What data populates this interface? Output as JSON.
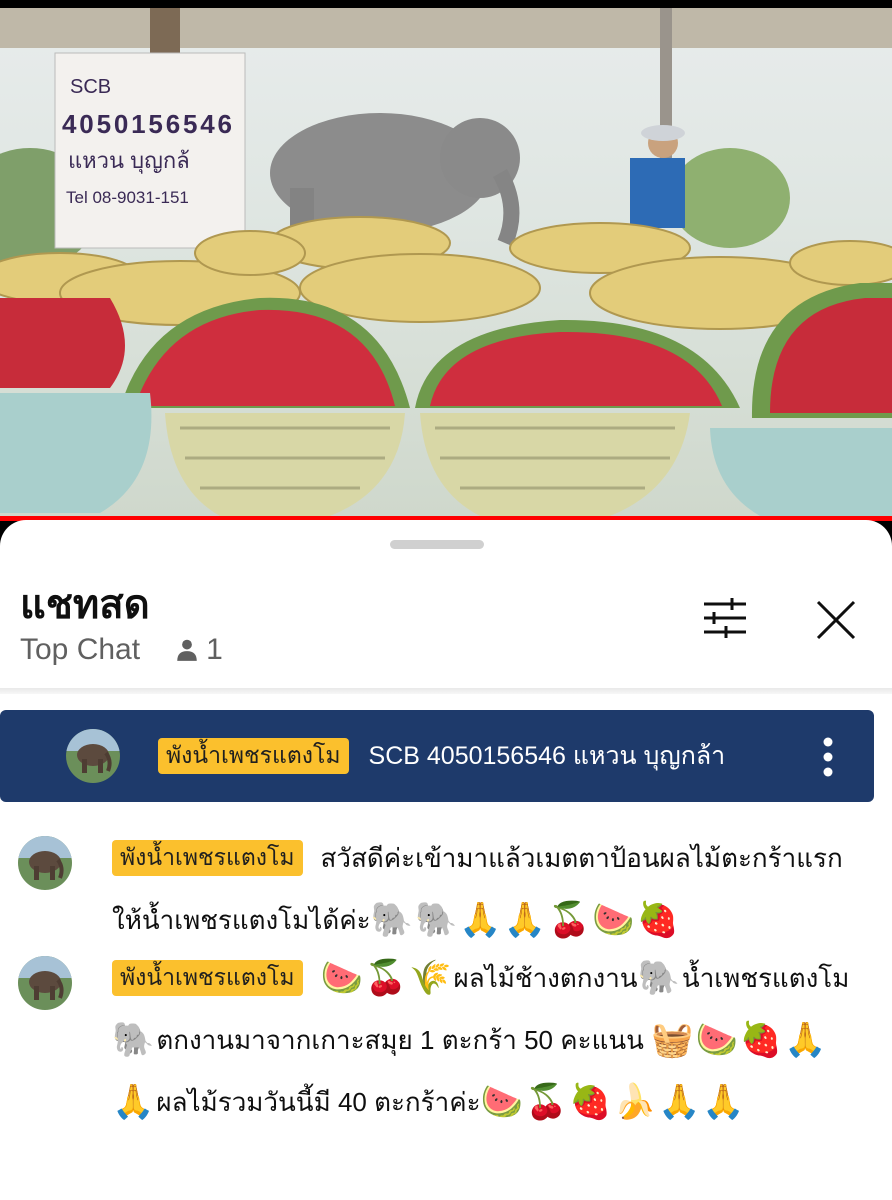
{
  "video": {
    "sign_lines": [
      "SCB",
      "4050156546",
      "แหวน บุญกล้",
      "Tel 08-9031-151"
    ]
  },
  "chat": {
    "title": "แชทสด",
    "mode": "Top Chat",
    "viewer_count": "1"
  },
  "pinned": {
    "author": "พังน้ำเพชรแตงโม",
    "text": "SCB 4050156546 แหวน บุญกล้า"
  },
  "messages": [
    {
      "author": "พังน้ำเพชรแตงโม",
      "text": "สวัสดีค่ะเข้ามาแล้วเมตตาป้อนผลไม้ตะกร้าแรกให้น้ำเพชรแตงโมได้ค่ะ",
      "emojis": "🐘🐘🙏🙏🍒🍉🍓"
    },
    {
      "author": "พังน้ำเพชรแตงโม",
      "lead_emojis": "🍉🍒🌾",
      "text_1": "ผลไม้ช้างตกงาน",
      "emoji_1": "🐘",
      "text_2": "น้ำเพชรแตงโม",
      "emoji_2": "🐘",
      "text_3": "ตกงานมาจากเกาะสมุย 1 ตะกร้า 50 คะแนน",
      "emojis_3": "🧺🍉🍓🙏🙏",
      "text_4": "ผลไม้รวมวันนี้มี 40 ตะกร้าค่ะ",
      "emojis_4": "🍉🍒🍓🍌🙏🙏"
    }
  ],
  "colors": {
    "progress": "#ff0000",
    "pinned_bg": "#1e3a6b",
    "author_chip": "#fbc02d"
  },
  "icons": {
    "filter": "sliders-icon",
    "close": "close-icon",
    "viewer": "person-icon",
    "menu": "more-vertical-icon"
  }
}
